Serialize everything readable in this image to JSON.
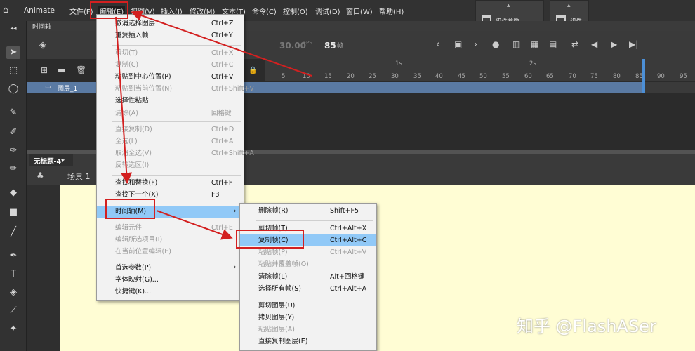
{
  "app": {
    "name": "Animate"
  },
  "menubar": {
    "items": [
      "文件(F)",
      "编辑(E)",
      "视图(V)",
      "插入(I)",
      "修改(M)",
      "文本(T)",
      "命令(C)",
      "控制(O)",
      "调试(D)",
      "窗口(W)",
      "帮助(H)"
    ]
  },
  "panels": {
    "component_params": "组件参数",
    "component": "组件"
  },
  "timeline": {
    "tab": "时间轴",
    "fps": "30.00",
    "fps_unit": "FPS",
    "frame": "85",
    "frame_unit": "帧",
    "layer_name": "图层_1",
    "ruler_labels": [
      "5",
      "10",
      "15",
      "20",
      "25",
      "30",
      "35",
      "40",
      "45",
      "50",
      "55",
      "60",
      "65",
      "70",
      "75",
      "80",
      "85",
      "90",
      "95"
    ],
    "sec_labels": [
      "1s",
      "2s"
    ]
  },
  "document": {
    "tab": "无标题-4*",
    "scene": "场景 1"
  },
  "edit_menu": {
    "items": [
      {
        "label": "撤消选择图层",
        "shortcut": "Ctrl+Z",
        "disabled": false
      },
      {
        "label": "重复插入帧",
        "shortcut": "Ctrl+Y",
        "disabled": false
      },
      {
        "label": "剪切(T)",
        "shortcut": "Ctrl+X",
        "disabled": true
      },
      {
        "label": "复制(C)",
        "shortcut": "Ctrl+C",
        "disabled": true
      },
      {
        "label": "粘贴到中心位置(P)",
        "shortcut": "Ctrl+V",
        "disabled": false
      },
      {
        "label": "粘贴到当前位置(N)",
        "shortcut": "Ctrl+Shift+V",
        "disabled": true
      },
      {
        "label": "选择性粘贴",
        "shortcut": "",
        "disabled": false
      },
      {
        "label": "清除(A)",
        "shortcut": "回格键",
        "disabled": true
      },
      {
        "label": "直接复制(D)",
        "shortcut": "Ctrl+D",
        "disabled": true
      },
      {
        "label": "全选(L)",
        "shortcut": "Ctrl+A",
        "disabled": true
      },
      {
        "label": "取消全选(V)",
        "shortcut": "Ctrl+Shift+A",
        "disabled": true
      },
      {
        "label": "反转选区(I)",
        "shortcut": "",
        "disabled": true
      },
      {
        "label": "查找和替换(F)",
        "shortcut": "Ctrl+F",
        "disabled": false
      },
      {
        "label": "查找下一个(X)",
        "shortcut": "F3",
        "disabled": false
      },
      {
        "label": "时间轴(M)",
        "shortcut": "",
        "disabled": false
      },
      {
        "label": "编辑元件",
        "shortcut": "Ctrl+E",
        "disabled": true
      },
      {
        "label": "编辑所选项目(I)",
        "shortcut": "",
        "disabled": true
      },
      {
        "label": "在当前位置编辑(E)",
        "shortcut": "",
        "disabled": true
      },
      {
        "label": "首选参数(P)",
        "shortcut": "",
        "disabled": false
      },
      {
        "label": "字体映射(G)...",
        "shortcut": "",
        "disabled": false
      },
      {
        "label": "快捷键(K)...",
        "shortcut": "",
        "disabled": false
      }
    ]
  },
  "timeline_submenu": {
    "items": [
      {
        "label": "删除帧(R)",
        "shortcut": "Shift+F5",
        "disabled": false
      },
      {
        "label": "剪切帧(T)",
        "shortcut": "Ctrl+Alt+X",
        "disabled": false
      },
      {
        "label": "复制帧(C)",
        "shortcut": "Ctrl+Alt+C",
        "disabled": false
      },
      {
        "label": "粘贴帧(P)",
        "shortcut": "Ctrl+Alt+V",
        "disabled": true
      },
      {
        "label": "粘贴并覆盖帧(O)",
        "shortcut": "",
        "disabled": true
      },
      {
        "label": "清除帧(L)",
        "shortcut": "Alt+回格键",
        "disabled": false
      },
      {
        "label": "选择所有帧(S)",
        "shortcut": "Ctrl+Alt+A",
        "disabled": false
      },
      {
        "label": "剪切图层(U)",
        "shortcut": "",
        "disabled": false
      },
      {
        "label": "拷贝图层(Y)",
        "shortcut": "",
        "disabled": false
      },
      {
        "label": "粘贴图层(A)",
        "shortcut": "",
        "disabled": true
      },
      {
        "label": "直接复制图层(E)",
        "shortcut": "",
        "disabled": false
      }
    ]
  },
  "watermark": "知乎 @FlashASer",
  "colors": {
    "highlight": "#91c9f7",
    "annotation": "#d32020",
    "stage": "#fffdd4",
    "layer": "#5a7aa3"
  }
}
